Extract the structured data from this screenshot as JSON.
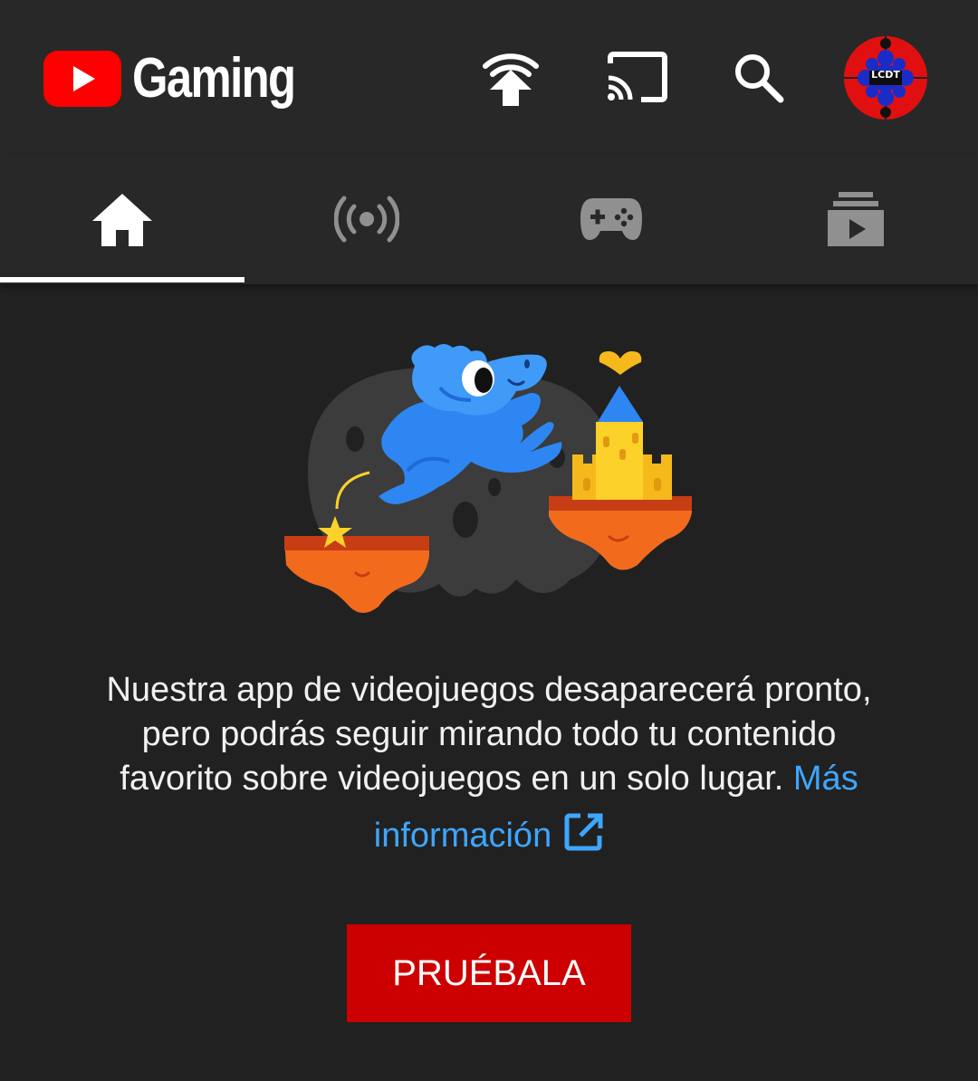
{
  "header": {
    "app_name": "Gaming",
    "avatar_label": "LCDT",
    "icons": [
      "youtube-play-logo",
      "upload-signal-icon",
      "cast-icon",
      "search-icon",
      "avatar"
    ]
  },
  "tabs": [
    {
      "icon": "home-icon",
      "selected": true
    },
    {
      "icon": "live-icon",
      "selected": false
    },
    {
      "icon": "gamepad-icon",
      "selected": false
    },
    {
      "icon": "library-icon",
      "selected": false
    }
  ],
  "main": {
    "message": "Nuestra app de videojuegos desaparecerá pronto, pero podrás seguir mirando todo tu contenido favorito sobre videojuegos en un solo lugar.",
    "message_line1": "Nuestra app de videojuegos desaparecerá pronto,",
    "message_line2": "pero podrás seguir mirando todo tu contenido",
    "message_line3": "favorito sobre videojuegos en un solo lugar.",
    "link_part1": "Más",
    "link_part2": "información",
    "cta_label": "PRUÉBALA"
  },
  "colors": {
    "background": "#212121",
    "header": "#282828",
    "brand_red": "#ff0000",
    "cta_red": "#cc0000",
    "link_blue": "#3ea6ff",
    "text": "#f1f1f1",
    "inactive_icon": "#909090"
  }
}
